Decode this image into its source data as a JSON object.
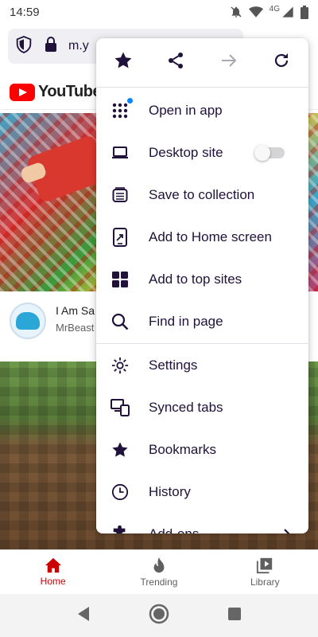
{
  "status_bar": {
    "time": "14:59",
    "network": "4G",
    "icons": [
      "notifications-off-icon",
      "wifi-icon",
      "cell-signal-icon",
      "battery-icon"
    ]
  },
  "url_bar": {
    "url_text": "m.y",
    "icons": [
      "tracking-protection-shield-icon",
      "lock-icon"
    ]
  },
  "page": {
    "logo_text": "YouTube",
    "video": {
      "title": "I Am Sa",
      "channel": "MrBeast"
    }
  },
  "menu": {
    "toolbar": [
      {
        "icon": "star-icon",
        "label": "Bookmark"
      },
      {
        "icon": "share-icon",
        "label": "Share"
      },
      {
        "icon": "forward-arrow-icon",
        "label": "Forward"
      },
      {
        "icon": "reload-icon",
        "label": "Reload"
      }
    ],
    "items": [
      {
        "label": "Open in app",
        "icon": "app-grid-icon"
      },
      {
        "label": "Desktop site",
        "icon": "laptop-icon"
      },
      {
        "label": "Save to collection",
        "icon": "collection-icon"
      },
      {
        "label": "Add to Home screen",
        "icon": "add-to-homescreen-icon"
      },
      {
        "label": "Add to top sites",
        "icon": "top-sites-icon"
      },
      {
        "label": "Find in page",
        "icon": "search-icon"
      },
      {
        "label": "Settings",
        "icon": "gear-icon"
      },
      {
        "label": "Synced tabs",
        "icon": "synced-tabs-icon"
      },
      {
        "label": "Bookmarks",
        "icon": "star-icon"
      },
      {
        "label": "History",
        "icon": "clock-icon"
      },
      {
        "label": "Add-ons",
        "icon": "puzzle-icon"
      }
    ],
    "desktop_site_enabled": false,
    "accent_color": "#0a84ff"
  },
  "bottom_nav": {
    "tabs": [
      {
        "label": "Home",
        "icon": "home-icon",
        "active": true
      },
      {
        "label": "Trending",
        "icon": "flame-icon",
        "active": false
      },
      {
        "label": "Library",
        "icon": "library-icon",
        "active": false
      }
    ],
    "active_color": "#cc0000"
  },
  "system_nav": {
    "buttons": [
      "back-icon",
      "home-circle-icon",
      "recents-square-icon"
    ]
  }
}
